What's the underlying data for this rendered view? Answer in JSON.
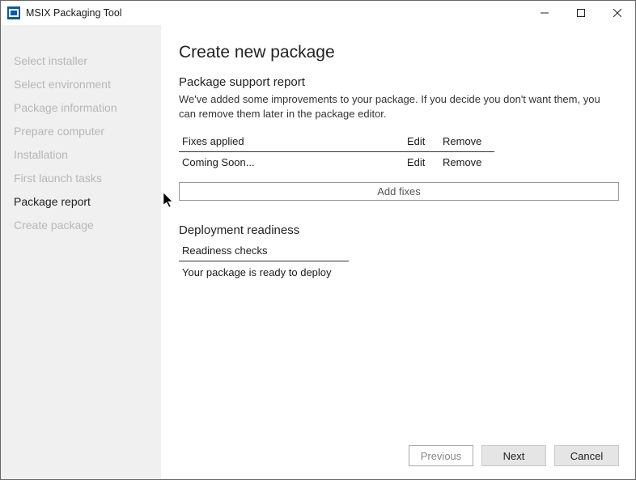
{
  "titlebar": {
    "title": "MSIX Packaging Tool"
  },
  "sidebar": {
    "steps": [
      {
        "label": "Select installer",
        "active": false
      },
      {
        "label": "Select environment",
        "active": false
      },
      {
        "label": "Package information",
        "active": false
      },
      {
        "label": "Prepare computer",
        "active": false
      },
      {
        "label": "Installation",
        "active": false
      },
      {
        "label": "First launch tasks",
        "active": false
      },
      {
        "label": "Package report",
        "active": true
      },
      {
        "label": "Create package",
        "active": false
      }
    ]
  },
  "main": {
    "page_title": "Create new package",
    "support_report": {
      "title": "Package support report",
      "description": "We've added some improvements to your package. If you decide you don't want them, you can remove them later in the package editor.",
      "header_name": "Fixes applied",
      "header_edit": "Edit",
      "header_remove": "Remove",
      "rows": [
        {
          "name": "Coming Soon...",
          "edit": "Edit",
          "remove": "Remove"
        }
      ],
      "add_fixes_label": "Add fixes"
    },
    "deployment": {
      "title": "Deployment readiness",
      "header": "Readiness checks",
      "status": "Your package is ready to deploy"
    },
    "footer": {
      "previous": "Previous",
      "next": "Next",
      "cancel": "Cancel"
    }
  }
}
